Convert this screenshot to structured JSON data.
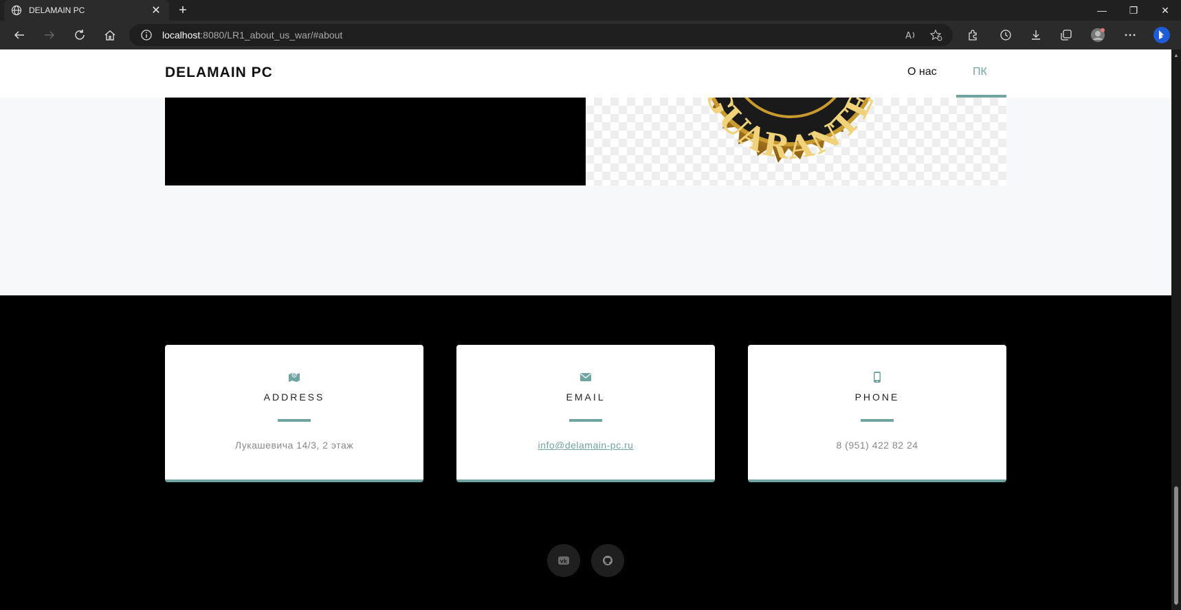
{
  "browser": {
    "tab_title": "DELAMAIN PC",
    "url_host": "localhost",
    "url_rest": ":8080/LR1_about_us_war/#about"
  },
  "site": {
    "brand": "DELAMAIN PC",
    "nav": [
      {
        "label": "О нас"
      },
      {
        "label": "ПК"
      }
    ],
    "seal_text": "GUARANTEED"
  },
  "contacts": [
    {
      "title": "ADDRESS",
      "value": "Лукашевича 14/3, 2 этаж",
      "icon": "map-icon"
    },
    {
      "title": "EMAIL",
      "value": "info@delamain-pc.ru",
      "icon": "envelope-icon"
    },
    {
      "title": "PHONE",
      "value": "8 (951) 422 82 24",
      "icon": "mobile-icon"
    }
  ],
  "social": [
    {
      "label": "VK",
      "icon": "vk-icon"
    },
    {
      "label": "GitHub",
      "icon": "github-icon"
    }
  ],
  "colors": {
    "accent": "#6fa4a0"
  }
}
